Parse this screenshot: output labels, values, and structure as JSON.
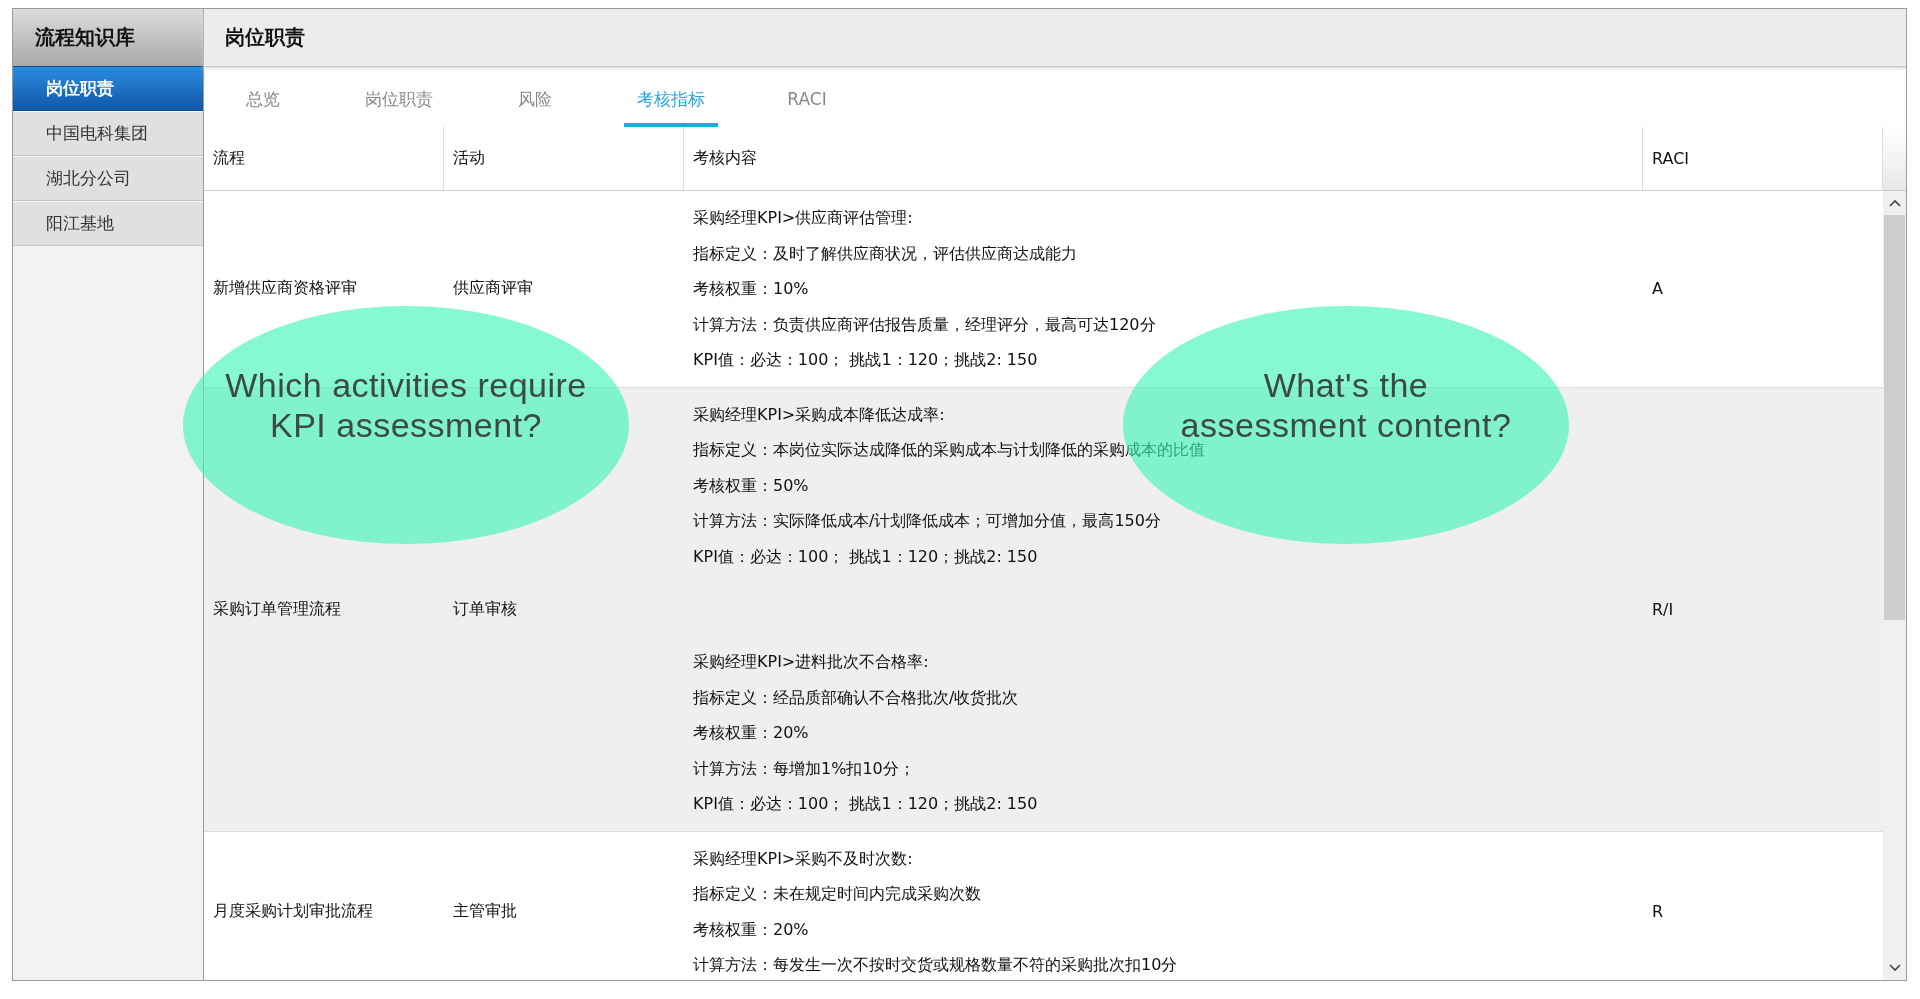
{
  "sidebar": {
    "title": "流程知识库",
    "items": [
      {
        "label": "岗位职责",
        "selected": true
      },
      {
        "label": "中国电科集团",
        "selected": false
      },
      {
        "label": "湖北分公司",
        "selected": false
      },
      {
        "label": "阳江基地",
        "selected": false
      }
    ]
  },
  "header": {
    "title": "岗位职责"
  },
  "tabs": [
    {
      "label": "总览",
      "selected": false
    },
    {
      "label": "岗位职责",
      "selected": false
    },
    {
      "label": "风险",
      "selected": false
    },
    {
      "label": "考核指标",
      "selected": true
    },
    {
      "label": "RACI",
      "selected": false
    }
  ],
  "table": {
    "columns": [
      "流程",
      "活动",
      "考核内容",
      "RACI"
    ],
    "rows": [
      {
        "process": "新增供应商资格评审",
        "activity": "供应商评审",
        "raci": "A",
        "kpis": [
          [
            "采购经理KPI>供应商评估管理:",
            "指标定义：及时了解供应商状况，评估供应商达成能力",
            "考核权重：10%",
            "计算方法：负责供应商评估报告质量，经理评分，最高可达120分",
            "KPI值：必达：100； 挑战1：120；挑战2: 150"
          ]
        ]
      },
      {
        "process": "采购订单管理流程",
        "activity": "订单审核",
        "raci": "R/I",
        "kpis": [
          [
            "采购经理KPI>采购成本降低达成率:",
            "指标定义：本岗位实际达成降低的采购成本与计划降低的采购成本的比值",
            "考核权重：50%",
            "计算方法：实际降低成本/计划降低成本；可增加分值，最高150分",
            "KPI值：必达：100； 挑战1：120；挑战2: 150"
          ],
          [
            "采购经理KPI>进料批次不合格率:",
            "指标定义：经品质部确认不合格批次/收货批次",
            "考核权重：20%",
            "计算方法：每增加1%扣10分；",
            "KPI值：必达：100； 挑战1：120；挑战2: 150"
          ]
        ]
      },
      {
        "process": "月度采购计划审批流程",
        "activity": "主管审批",
        "raci": "R",
        "kpis": [
          [
            "采购经理KPI>采购不及时次数:",
            "指标定义：未在规定时间内完成采购次数",
            "考核权重：20%",
            "计算方法：每发生一次不按时交货或规格数量不符的采购批次扣10分"
          ]
        ]
      }
    ]
  },
  "callouts": [
    {
      "text": "Which activities require\nKPI assessment?"
    },
    {
      "text": "What's the\nassessment content?"
    }
  ]
}
